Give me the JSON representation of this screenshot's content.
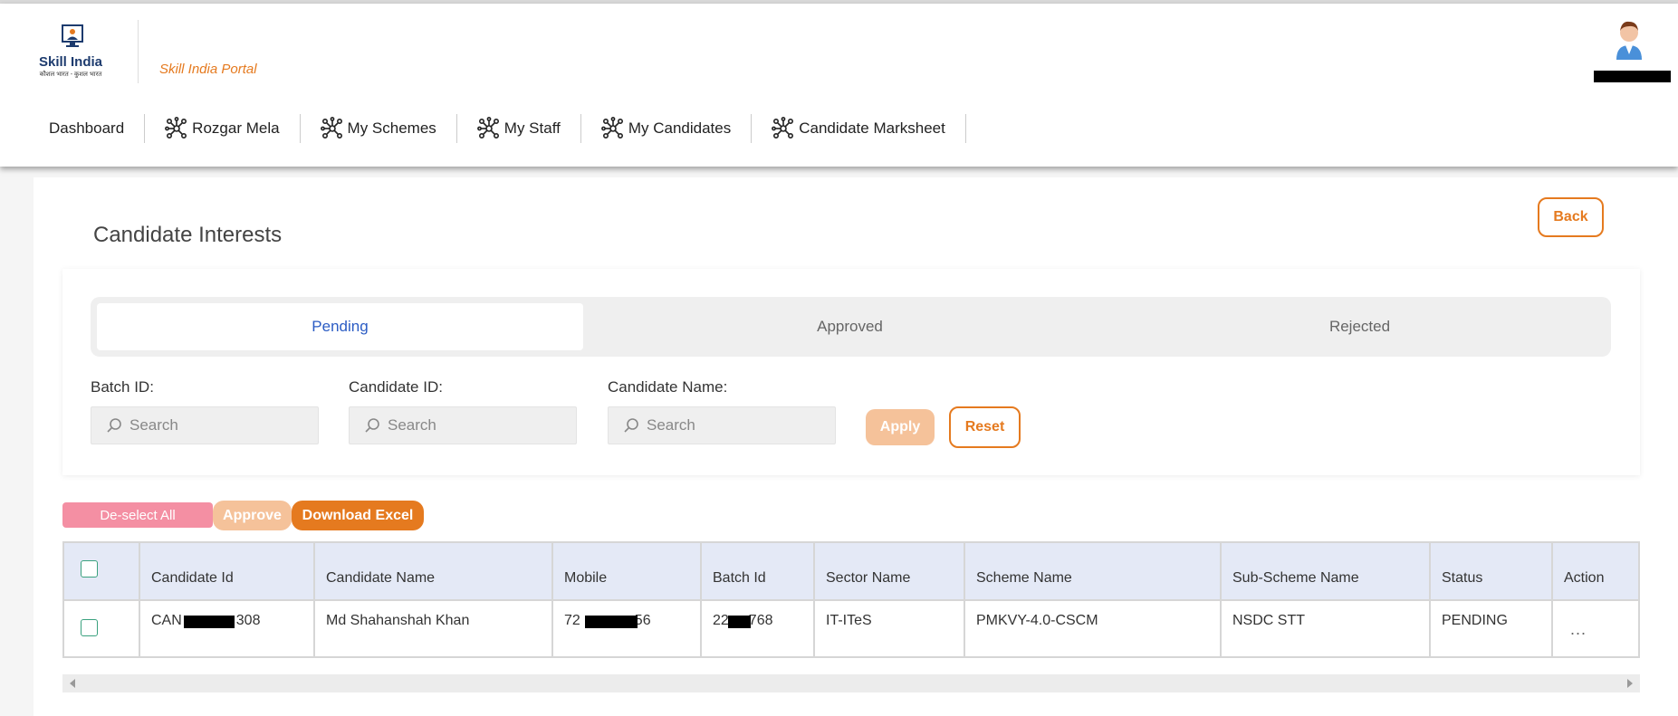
{
  "header": {
    "logo_name": "Skill India",
    "logo_tagline": "कौशल भारत - कुशल भारत",
    "portal_name": "Skill India Portal"
  },
  "nav": {
    "items": [
      {
        "label": "Dashboard",
        "icon": ""
      },
      {
        "label": "Rozgar Mela",
        "icon": "network-icon"
      },
      {
        "label": "My Schemes",
        "icon": "network-icon"
      },
      {
        "label": "My Staff",
        "icon": "network-icon"
      },
      {
        "label": "My Candidates",
        "icon": "network-icon"
      },
      {
        "label": "Candidate Marksheet",
        "icon": "network-icon"
      }
    ]
  },
  "page": {
    "title": "Candidate Interests",
    "back_label": "Back"
  },
  "tabs": [
    {
      "label": "Pending",
      "active": true
    },
    {
      "label": "Approved",
      "active": false
    },
    {
      "label": "Rejected",
      "active": false
    }
  ],
  "filters": {
    "batch_label": "Batch ID:",
    "candidate_id_label": "Candidate ID:",
    "candidate_name_label": "Candidate Name:",
    "placeholder": "Search",
    "apply_label": "Apply",
    "reset_label": "Reset"
  },
  "actions": {
    "deselect_label": "De-select All",
    "approve_label": "Approve",
    "excel_label": "Download Excel"
  },
  "table": {
    "headers": {
      "candidate_id": "Candidate Id",
      "candidate_name": "Candidate Name",
      "mobile": "Mobile",
      "batch_id": "Batch Id",
      "sector": "Sector Name",
      "scheme": "Scheme Name",
      "sub_scheme": "Sub-Scheme Name",
      "status": "Status",
      "action": "Action"
    },
    "rows": [
      {
        "candidate_id_prefix": "CAN",
        "candidate_id_suffix": "308",
        "candidate_name": "Md Shahanshah Khan",
        "mobile_prefix": "72",
        "mobile_suffix": "56",
        "batch_id_prefix": "22",
        "batch_id_suffix": "768",
        "sector": "IT-ITeS",
        "scheme": "PMKVY-4.0-CSCM",
        "sub_scheme": "NSDC STT",
        "status": "PENDING",
        "action": "..."
      }
    ]
  },
  "colors": {
    "brand_orange": "#e57a1f",
    "active_tab_blue": "#2b5cc4",
    "header_row": "#e4e9f6"
  }
}
